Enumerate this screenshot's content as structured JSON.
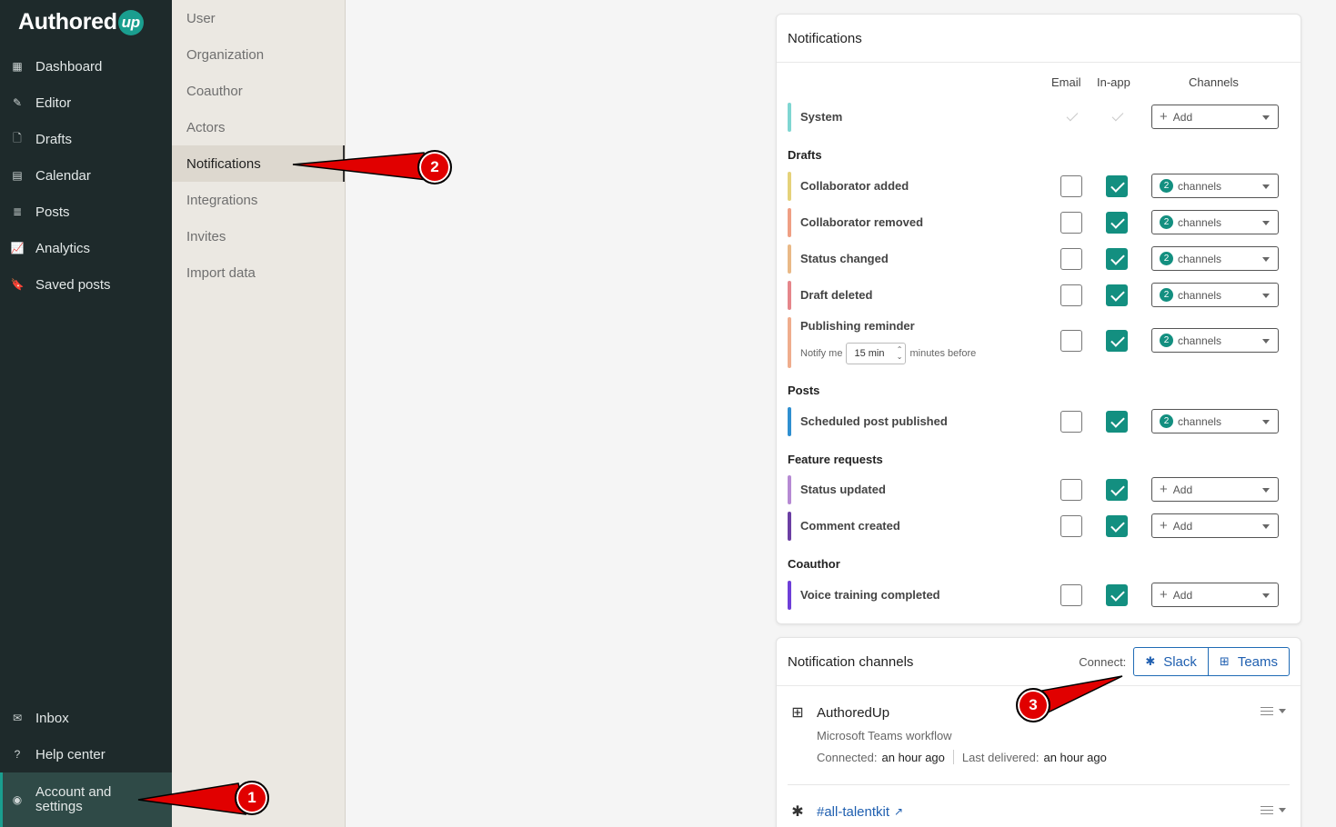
{
  "brand": {
    "name": "Authored",
    "mark": "up"
  },
  "sidebar": {
    "items": [
      {
        "label": "Dashboard",
        "icon": "grid-icon"
      },
      {
        "label": "Editor",
        "icon": "pencil-icon"
      },
      {
        "label": "Drafts",
        "icon": "file-icon"
      },
      {
        "label": "Calendar",
        "icon": "calendar-icon"
      },
      {
        "label": "Posts",
        "icon": "stack-icon"
      },
      {
        "label": "Analytics",
        "icon": "chart-icon"
      },
      {
        "label": "Saved posts",
        "icon": "bookmark-icon"
      }
    ],
    "bottom": [
      {
        "label": "Inbox",
        "icon": "inbox-icon"
      },
      {
        "label": "Help center",
        "icon": "help-icon"
      }
    ],
    "account": {
      "label_line1": "Account and",
      "label_line2": "settings",
      "icon": "user-circle-icon"
    }
  },
  "settings_menu": {
    "items": [
      "User",
      "Organization",
      "Coauthor",
      "Actors",
      "Notifications",
      "Integrations",
      "Invites",
      "Import data"
    ],
    "active": "Notifications"
  },
  "notifications": {
    "title": "Notifications",
    "columns": {
      "email": "Email",
      "inapp": "In-app",
      "channels": "Channels"
    },
    "system": {
      "name": "System",
      "channel": "Add"
    },
    "sections": {
      "drafts": "Drafts",
      "posts": "Posts",
      "feature_requests": "Feature requests",
      "coauthor": "Coauthor"
    },
    "rows": {
      "collab_added": {
        "name": "Collaborator added",
        "email": false,
        "inapp": true,
        "count": "2",
        "channel": "channels"
      },
      "collab_removed": {
        "name": "Collaborator removed",
        "email": false,
        "inapp": true,
        "count": "2",
        "channel": "channels"
      },
      "status_changed": {
        "name": "Status changed",
        "email": false,
        "inapp": true,
        "count": "2",
        "channel": "channels"
      },
      "draft_deleted": {
        "name": "Draft deleted",
        "email": false,
        "inapp": true,
        "count": "2",
        "channel": "channels"
      },
      "publishing_reminder": {
        "name": "Publishing reminder",
        "email": false,
        "inapp": true,
        "count": "2",
        "channel": "channels",
        "notify_prefix": "Notify me",
        "notify_value": "15 min",
        "notify_suffix": "minutes before"
      },
      "scheduled_published": {
        "name": "Scheduled post published",
        "email": false,
        "inapp": true,
        "count": "2",
        "channel": "channels"
      },
      "status_updated": {
        "name": "Status updated",
        "email": false,
        "inapp": true,
        "channel": "Add"
      },
      "comment_created": {
        "name": "Comment created",
        "email": false,
        "inapp": true,
        "channel": "Add"
      },
      "voice_training": {
        "name": "Voice training completed",
        "email": false,
        "inapp": true,
        "channel": "Add"
      }
    },
    "colors": {
      "system": "#7fd6d2",
      "collab_added": "#e5d27a",
      "collab_removed": "#ef9f84",
      "status_changed": "#e9b987",
      "draft_deleted": "#e5868b",
      "publishing_reminder": "#efad8d",
      "scheduled_published": "#2f8fd0",
      "status_updated": "#b68ad3",
      "comment_created": "#6b3fa3",
      "voice_training": "#6e3fd8",
      "accent": "#138f80"
    }
  },
  "channels_card": {
    "title": "Notification channels",
    "connect_label": "Connect:",
    "slack": "Slack",
    "teams": "Teams",
    "items": [
      {
        "name": "AuthoredUp",
        "type": "Microsoft Teams workflow",
        "connected_label": "Connected:",
        "connected_value": "an hour ago",
        "delivered_label": "Last delivered:",
        "delivered_value": "an hour ago"
      },
      {
        "name": "#all-talentkit"
      }
    ]
  },
  "annotations": [
    "1",
    "2",
    "3"
  ]
}
